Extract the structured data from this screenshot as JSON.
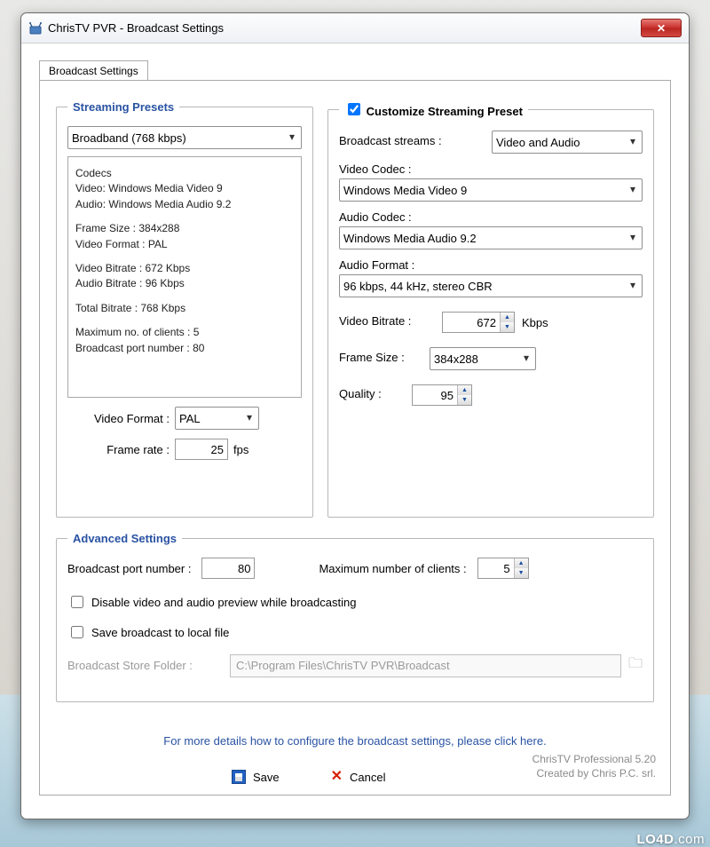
{
  "window": {
    "title": "ChrisTV PVR - Broadcast Settings"
  },
  "tab": {
    "label": "Broadcast Settings"
  },
  "streaming": {
    "legend": "Streaming Presets",
    "preset": "Broadband (768 kbps)",
    "codecs_heading": "Codecs",
    "video_codec_line": "Video: Windows Media Video 9",
    "audio_codec_line": "Audio: Windows Media Audio 9.2",
    "frame_size_line": "Frame Size  :    384x288",
    "video_format_line": "Video Format :    PAL",
    "video_bitrate_line": "Video Bitrate :   672 Kbps",
    "audio_bitrate_line": "Audio Bitrate :   96 Kbps",
    "total_bitrate_line": "Total Bitrate  :   768 Kbps",
    "max_clients_line": "Maximum no. of clients :   5",
    "port_line": "Broadcast port number :   80",
    "video_format_label": "Video Format :",
    "video_format_value": "PAL",
    "frame_rate_label": "Frame rate :",
    "frame_rate_value": "25",
    "frame_rate_unit": "fps"
  },
  "customize": {
    "legend": "Customize Streaming Preset",
    "checked": true,
    "broadcast_streams_label": "Broadcast streams :",
    "broadcast_streams_value": "Video and Audio",
    "video_codec_label": "Video Codec :",
    "video_codec_value": "Windows Media Video 9",
    "audio_codec_label": "Audio Codec :",
    "audio_codec_value": "Windows Media Audio 9.2",
    "audio_format_label": "Audio Format :",
    "audio_format_value": "96 kbps, 44 kHz, stereo CBR",
    "video_bitrate_label": "Video Bitrate :",
    "video_bitrate_value": "672",
    "video_bitrate_unit": "Kbps",
    "frame_size_label": "Frame Size :",
    "frame_size_value": "384x288",
    "quality_label": "Quality :",
    "quality_value": "95"
  },
  "advanced": {
    "legend": "Advanced Settings",
    "port_label": "Broadcast port number :",
    "port_value": "80",
    "max_clients_label": "Maximum number of clients :",
    "max_clients_value": "5",
    "disable_preview_label": "Disable video and audio preview while broadcasting",
    "save_local_label": "Save broadcast to local file",
    "folder_label": "Broadcast Store Folder :",
    "folder_value": "C:\\Program Files\\ChrisTV PVR\\Broadcast"
  },
  "help_link": "For more details how to configure the broadcast settings, please click here.",
  "buttons": {
    "save": "Save",
    "cancel": "Cancel"
  },
  "credit": {
    "line1": "ChrisTV Professional 5.20",
    "line2": "Created by Chris P.C. srl."
  },
  "watermark": {
    "brand": "LO4D",
    "tld": ".com"
  }
}
